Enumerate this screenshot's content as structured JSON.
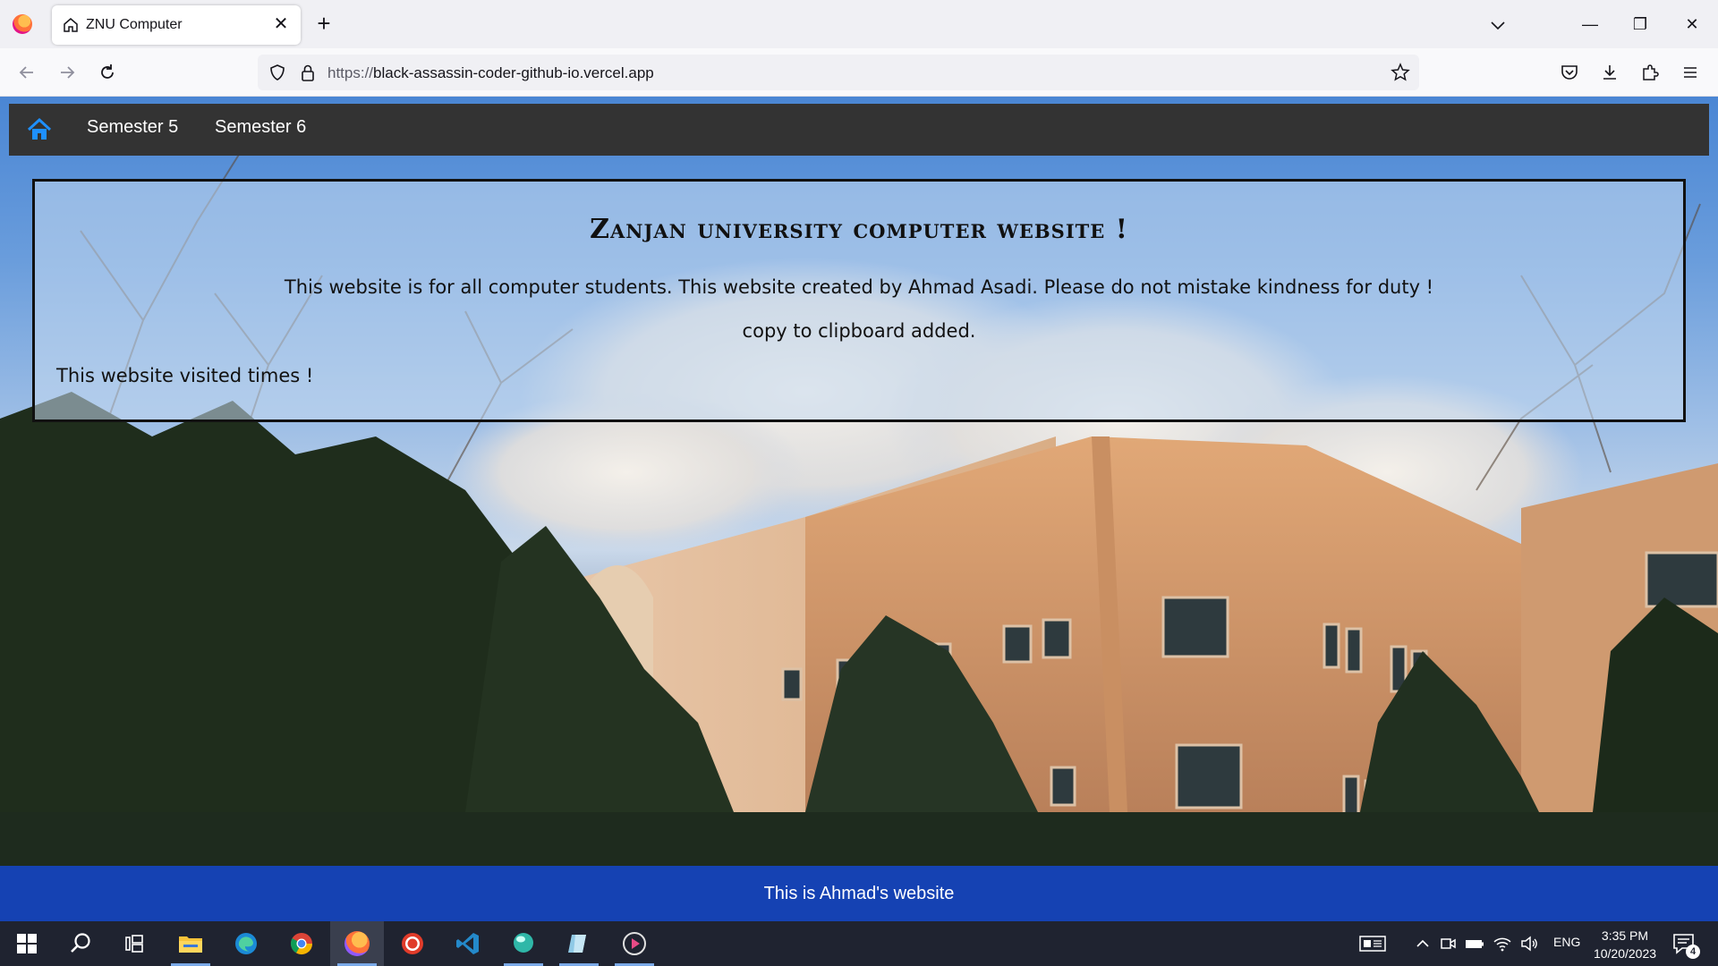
{
  "browser": {
    "tab_title": "ZNU Computer",
    "tab_close": "✕",
    "new_tab": "+",
    "url_protocol": "https://",
    "url_host": "black-assassin-coder-github-io.vercel.app",
    "window_controls": {
      "minimize": "—",
      "restore": "❐",
      "close": "✕"
    }
  },
  "site": {
    "nav": {
      "links": [
        "Semester 5",
        "Semester 6"
      ],
      "accent": "#1e90ff"
    },
    "intro": {
      "title": "Zanjan university computer website !",
      "description": "This website is for all computer students. This website created by Ahmad Asadi. Please do not mistake kindness for duty !",
      "clipboard_note": "copy to clipboard added.",
      "visits": "This website visited times !"
    },
    "footer": {
      "text": "This is Ahmad's website",
      "color": "#1446c8"
    }
  },
  "taskbar": {
    "apps": [
      "start-icon",
      "search-icon",
      "task-view-icon",
      "file-explorer-icon",
      "edge-icon",
      "chrome-icon",
      "firefox-icon",
      "recorder-icon",
      "vscode-icon",
      "app-icon",
      "app-icon-2",
      "media-player-icon"
    ],
    "active_app": "firefox-icon",
    "tray": {
      "language": "ENG",
      "time": "3:35 PM",
      "date": "10/20/2023",
      "notifications": "4"
    }
  }
}
